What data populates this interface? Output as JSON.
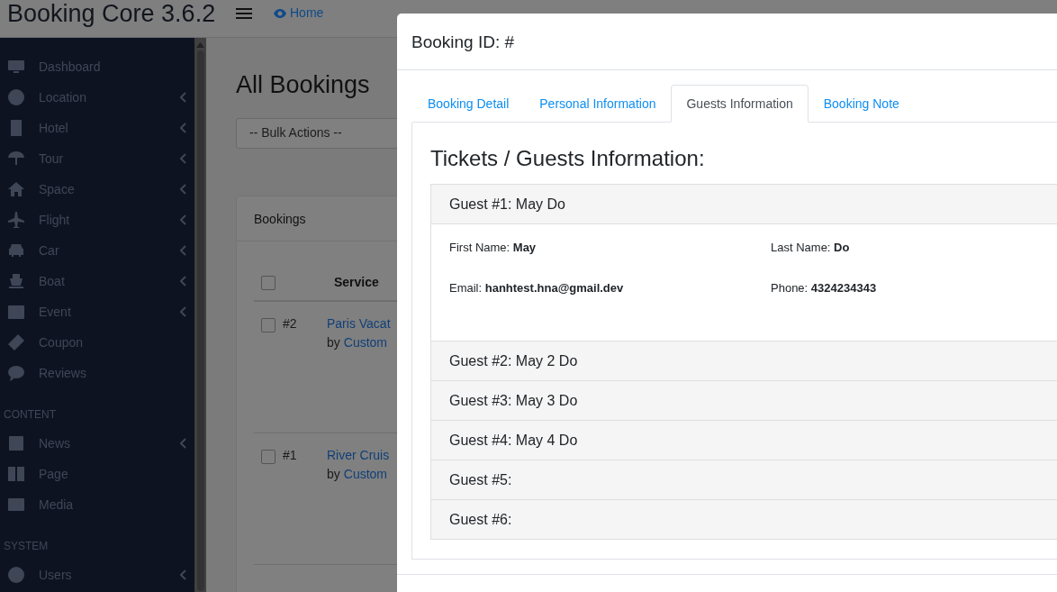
{
  "topbar": {
    "brand": "Booking Core 3.6.2",
    "home_link": "Home"
  },
  "sidebar": {
    "groups": [
      {
        "items": [
          {
            "label": "Dashboard",
            "expandable": false
          },
          {
            "label": "Location",
            "expandable": true
          },
          {
            "label": "Hotel",
            "expandable": true
          },
          {
            "label": "Tour",
            "expandable": true
          },
          {
            "label": "Space",
            "expandable": true
          },
          {
            "label": "Flight",
            "expandable": true
          },
          {
            "label": "Car",
            "expandable": true
          },
          {
            "label": "Boat",
            "expandable": true
          },
          {
            "label": "Event",
            "expandable": true
          },
          {
            "label": "Coupon",
            "expandable": false
          },
          {
            "label": "Reviews",
            "expandable": false
          }
        ]
      },
      {
        "heading": "CONTENT",
        "items": [
          {
            "label": "News",
            "expandable": true
          },
          {
            "label": "Page",
            "expandable": false
          },
          {
            "label": "Media",
            "expandable": false
          }
        ]
      },
      {
        "heading": "SYSTEM",
        "items": [
          {
            "label": "Users",
            "expandable": true
          }
        ]
      }
    ]
  },
  "page": {
    "title": "All Bookings",
    "bulk_actions": "-- Bulk Actions --",
    "card_title": "Bookings",
    "table": {
      "select_all_checked": false,
      "columns": [
        "Service"
      ],
      "rows": [
        {
          "checked": false,
          "id": "#2",
          "service": "Paris Vacat",
          "by": "by",
          "customer": "Custom"
        },
        {
          "checked": false,
          "id": "#1",
          "service": "River Cruis",
          "by": "by",
          "customer": "Custom"
        }
      ]
    }
  },
  "modal": {
    "title": "Booking ID: #",
    "tabs": [
      {
        "label": "Booking Detail",
        "selected": false
      },
      {
        "label": "Personal Information",
        "selected": false
      },
      {
        "label": "Guests Information",
        "selected": true
      },
      {
        "label": "Booking Note",
        "selected": false
      }
    ],
    "heading": "Tickets / Guests Information:",
    "guests": [
      {
        "title": "Guest #1: May Do",
        "expanded": true,
        "fields": [
          {
            "label": "First Name:",
            "value": "May"
          },
          {
            "label": "Last Name:",
            "value": "Do"
          },
          {
            "label": "Email:",
            "value": "hanhtest.hna@gmail.dev"
          },
          {
            "label": "Phone:",
            "value": "4324234343"
          }
        ]
      },
      {
        "title": "Guest #2: May 2 Do",
        "expanded": false
      },
      {
        "title": "Guest #3: May 3 Do",
        "expanded": false
      },
      {
        "title": "Guest #4: May 4 Do",
        "expanded": false
      },
      {
        "title": "Guest #5:",
        "expanded": false
      },
      {
        "title": "Guest #6:",
        "expanded": false
      }
    ]
  }
}
